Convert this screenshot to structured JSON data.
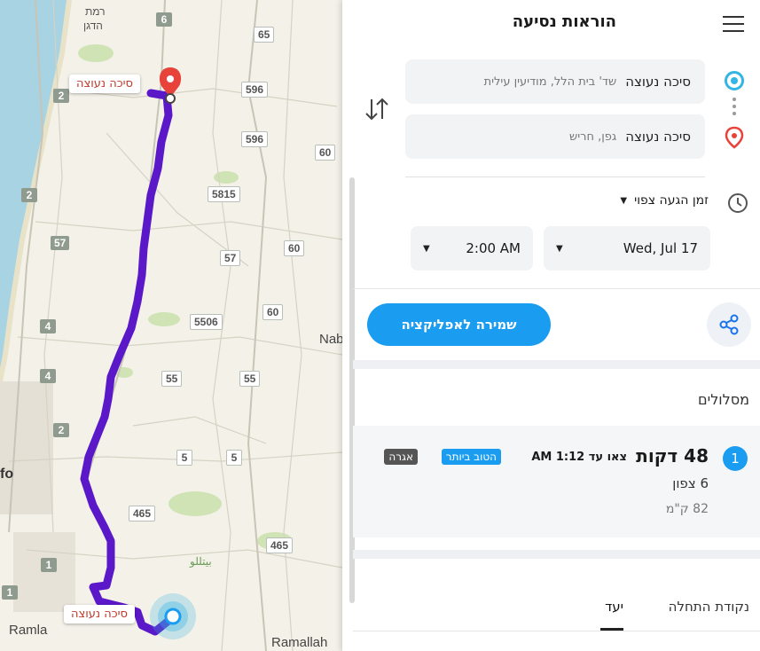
{
  "map": {
    "origin_label": "סיכה נעוצה",
    "dest_label": "סיכה נעוצה",
    "place_labels": {
      "ramat_hadgan_1": "רמת",
      "ramat_hadgan_2": "הדגן",
      "nablus_partial": "Nab",
      "jaffa_partial": "fo",
      "ramla": "Ramla",
      "ramallah": "Ramallah",
      "arabic_text": "بيتللو"
    },
    "road_shields": [
      "6",
      "65",
      "596",
      "596",
      "60",
      "5815",
      "2",
      "57",
      "60",
      "57",
      "5506",
      "60",
      "4",
      "55",
      "55",
      "5",
      "5",
      "465",
      "465",
      "1",
      "1",
      "2",
      "4",
      "2"
    ]
  },
  "panel": {
    "title": "הוראות נסיעה",
    "origin": {
      "name": "סיכה נעוצה",
      "address": "שד' בית הלל, מודיעין עילית"
    },
    "destination": {
      "name": "סיכה נעוצה",
      "address": "גפן, חריש"
    },
    "arrival": {
      "label": "זמן הגעה צפוי",
      "time": "2:00 AM",
      "date": "Wed, Jul 17"
    },
    "save_button": "שמירה לאפליקציה",
    "routes_header": "מסלולים",
    "route": {
      "number": "1",
      "duration": "48 דקות",
      "leave_by": "צאו עד 1:12 AM",
      "badge_best": "הטוב ביותר",
      "badge_toll": "אגרה",
      "via": "6 צפון",
      "distance": "82 ק\"מ"
    },
    "tabs": {
      "start": "נקודת התחלה",
      "dest": "יעד"
    }
  }
}
